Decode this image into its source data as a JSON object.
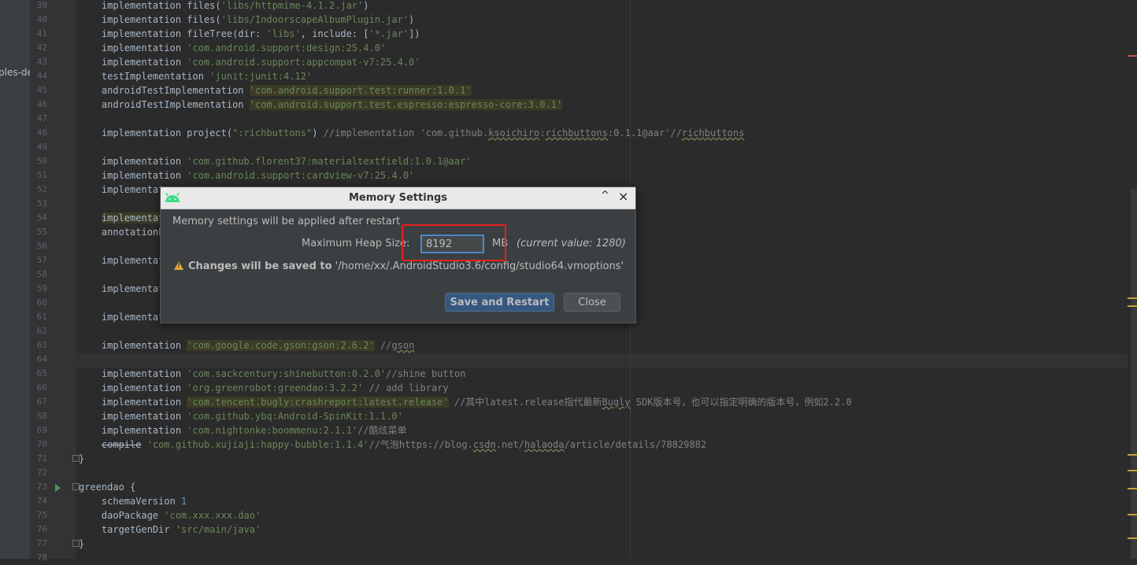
{
  "side": {
    "fragment": "ples-de"
  },
  "editor": {
    "lines": [
      {
        "n": "39",
        "segs": [
          {
            "t": "    implementation files("
          },
          {
            "t": "'libs/httpmime-4.1.2.jar'",
            "c": "str"
          },
          {
            "t": ")"
          }
        ]
      },
      {
        "n": "40",
        "segs": [
          {
            "t": "    implementation files("
          },
          {
            "t": "'libs/IndoorscapeAlbumPlugin.jar'",
            "c": "str"
          },
          {
            "t": ")"
          }
        ]
      },
      {
        "n": "41",
        "segs": [
          {
            "t": "    implementation fileTree(dir: "
          },
          {
            "t": "'libs'",
            "c": "str"
          },
          {
            "t": ", include: ["
          },
          {
            "t": "'*.jar'",
            "c": "str"
          },
          {
            "t": "])"
          }
        ]
      },
      {
        "n": "42",
        "segs": [
          {
            "t": "    implementation "
          },
          {
            "t": "'com.android.support:design:25.4.0'",
            "c": "str"
          }
        ]
      },
      {
        "n": "43",
        "segs": [
          {
            "t": "    implementation "
          },
          {
            "t": "'com.android.support:appcompat-v7:25.4.0'",
            "c": "str"
          }
        ]
      },
      {
        "n": "44",
        "segs": [
          {
            "t": "    testImplementation "
          },
          {
            "t": "'junit:junit:4.12'",
            "c": "str"
          }
        ]
      },
      {
        "n": "45",
        "segs": [
          {
            "t": "    androidTestImplementation "
          },
          {
            "t": "'com.android.support.test:runner:1.0.1'",
            "c": "str hl"
          }
        ]
      },
      {
        "n": "46",
        "segs": [
          {
            "t": "    androidTestImplementation "
          },
          {
            "t": "'com.android.support.test.espresso:espresso-core:3.0.1'",
            "c": "str hl"
          }
        ]
      },
      {
        "n": "47",
        "segs": []
      },
      {
        "n": "48",
        "segs": [
          {
            "t": "    implementation project("
          },
          {
            "t": "\":richbuttons\"",
            "c": "str"
          },
          {
            "t": ") "
          },
          {
            "t": "//implementation 'com.github.",
            "c": "cm"
          },
          {
            "t": "ksoichiro",
            "c": "cm wav"
          },
          {
            "t": ":",
            "c": "cm"
          },
          {
            "t": "richbuttons",
            "c": "cm wav"
          },
          {
            "t": ":0.1.1@aar'//",
            "c": "cm"
          },
          {
            "t": "richbuttons",
            "c": "cm wav"
          }
        ]
      },
      {
        "n": "49",
        "segs": []
      },
      {
        "n": "50",
        "segs": [
          {
            "t": "    implementation "
          },
          {
            "t": "'com.github.florent37:materialtextfield:1.0.1@aar'",
            "c": "str"
          }
        ]
      },
      {
        "n": "51",
        "segs": [
          {
            "t": "    implementation "
          },
          {
            "t": "'com.android.support:cardview-v7:25.4.0'",
            "c": "str"
          }
        ]
      },
      {
        "n": "52",
        "segs": [
          {
            "t": "    implementat"
          }
        ]
      },
      {
        "n": "53",
        "segs": []
      },
      {
        "n": "54",
        "segs": [
          {
            "t": "    "
          },
          {
            "t": "implementat",
            "c": "hl"
          }
        ]
      },
      {
        "n": "55",
        "segs": [
          {
            "t": "    annotationP"
          }
        ]
      },
      {
        "n": "56",
        "segs": []
      },
      {
        "n": "57",
        "segs": [
          {
            "t": "    implementat"
          }
        ]
      },
      {
        "n": "58",
        "segs": []
      },
      {
        "n": "59",
        "segs": [
          {
            "t": "    implementat"
          }
        ]
      },
      {
        "n": "60",
        "segs": []
      },
      {
        "n": "61",
        "segs": [
          {
            "t": "    implementat"
          }
        ]
      },
      {
        "n": "62",
        "segs": []
      },
      {
        "n": "63",
        "segs": [
          {
            "t": "    implementation "
          },
          {
            "t": "'com.google.code.gson:gson:2.6.2'",
            "c": "str hl"
          },
          {
            "t": " "
          },
          {
            "t": "//",
            "c": "cm"
          },
          {
            "t": "gson",
            "c": "cm wav"
          }
        ]
      },
      {
        "n": "64",
        "segs": []
      },
      {
        "n": "65",
        "segs": [
          {
            "t": "    implementation "
          },
          {
            "t": "'com.sackcentury:shinebutton:0.2.0'",
            "c": "str"
          },
          {
            "t": "//shine button",
            "c": "cm"
          }
        ]
      },
      {
        "n": "66",
        "segs": [
          {
            "t": "    implementation "
          },
          {
            "t": "'org.greenrobot:greendao:3.2.2'",
            "c": "str"
          },
          {
            "t": " // add library",
            "c": "cm"
          }
        ]
      },
      {
        "n": "67",
        "segs": [
          {
            "t": "    implementation "
          },
          {
            "t": "'com.tencent.bugly:crashreport:latest.release'",
            "c": "str hl"
          },
          {
            "t": " //其中latest.release指代最新",
            "c": "cm"
          },
          {
            "t": "Bugly",
            "c": "cm wav"
          },
          {
            "t": " SDK版本号，也可以指定明确的版本号，例如2.2.0",
            "c": "cm"
          }
        ]
      },
      {
        "n": "68",
        "segs": [
          {
            "t": "    implementation "
          },
          {
            "t": "'com.github.ybq:Android-SpinKit:1.1.0'",
            "c": "str"
          }
        ]
      },
      {
        "n": "69",
        "segs": [
          {
            "t": "    implementation "
          },
          {
            "t": "'com.nightonke:boommenu:2.1.1'",
            "c": "str"
          },
          {
            "t": "//酷炫菜单",
            "c": "cm"
          }
        ]
      },
      {
        "n": "70",
        "segs": [
          {
            "t": "    "
          },
          {
            "t": "compile",
            "c": "strike"
          },
          {
            "t": " "
          },
          {
            "t": "'com.github.xujiaji:happy-bubble:1.1.4'",
            "c": "str"
          },
          {
            "t": "//气泡https://blog.",
            "c": "cm"
          },
          {
            "t": "csdn",
            "c": "cm wav"
          },
          {
            "t": ".net/",
            "c": "cm"
          },
          {
            "t": "halaoda",
            "c": "cm wav"
          },
          {
            "t": "/article/details/78829882",
            "c": "cm"
          }
        ]
      },
      {
        "n": "71",
        "segs": [
          {
            "t": "}"
          }
        ]
      },
      {
        "n": "72",
        "segs": []
      },
      {
        "n": "73",
        "segs": [
          {
            "t": "greendao {"
          }
        ]
      },
      {
        "n": "74",
        "segs": [
          {
            "t": "    schemaVersion "
          },
          {
            "t": "1",
            "c": "num"
          }
        ]
      },
      {
        "n": "75",
        "segs": [
          {
            "t": "    daoPackage "
          },
          {
            "t": "'com.xxx.xxx.dao'",
            "c": "str"
          }
        ]
      },
      {
        "n": "76",
        "segs": [
          {
            "t": "    targetGenDir "
          },
          {
            "t": "'src/main/java'",
            "c": "str"
          }
        ]
      },
      {
        "n": "77",
        "segs": [
          {
            "t": "}"
          }
        ]
      },
      {
        "n": "78",
        "segs": []
      }
    ]
  },
  "dialog": {
    "title": "Memory Settings",
    "collapse_glyph": "^",
    "close_glyph": "×",
    "info_text": "Memory settings will be applied after restart",
    "heap_label": "Maximum Heap Size:",
    "heap_value": "8192",
    "unit": "MB",
    "current_value": "(current value: 1280)",
    "warning_bold": "Changes will be saved to",
    "warning_path": " '/home/xx/.AndroidStudio3.6/config/studio64.vmoptions'",
    "save_button": "Save and Restart",
    "close_button": "Close"
  },
  "colors": {
    "editor_bg": "#2b2b2b",
    "string": "#6a8759",
    "comment": "#808080",
    "primary_button": "#365880",
    "highlight_box": "#e8201b",
    "warning": "#e0a833"
  }
}
